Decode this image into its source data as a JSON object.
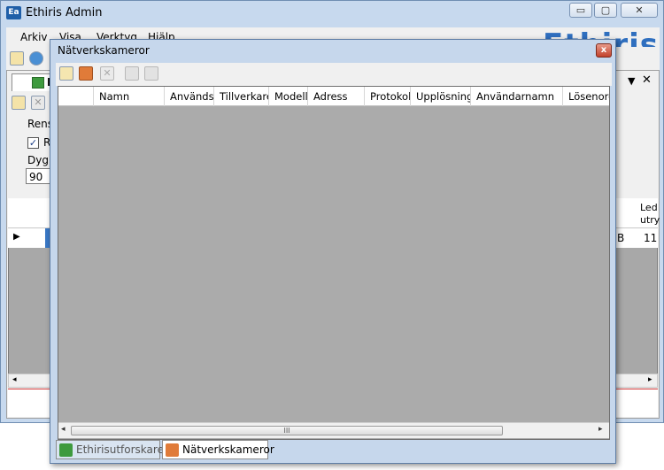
{
  "app": {
    "icon_text": "Ea",
    "title": "Ethiris Admin",
    "logo_text": "Ethiris"
  },
  "window_controls": {
    "minimize": "▭",
    "maximize": "▢",
    "close": "✕"
  },
  "menu": [
    "Arkiv",
    "Visa",
    "Verktyg",
    "Hjälp"
  ],
  "background_panel": {
    "tab_label": "L",
    "clear_label": "Rensa",
    "checkbox_label": "R",
    "checkbox_checked": true,
    "days_label": "Dygn",
    "days_value": "90",
    "grid_header_right": [
      "Led",
      "utry"
    ],
    "grid_row_value_b": "B",
    "grid_row_value_num": "11"
  },
  "dialog": {
    "title": "Nätverkskameror",
    "close_label": "x",
    "columns": [
      "Namn",
      "Används",
      "Tillverkare",
      "Modell",
      "Adress",
      "Protokoll",
      "Upplösning",
      "Användarnamn",
      "Lösenord"
    ],
    "scroll_grip": "III",
    "tabs": [
      {
        "label": "Ethirisutforskaren",
        "icon": "explorer-icon",
        "active": false
      },
      {
        "label": "Nätverkskameror",
        "icon": "camera-icon",
        "active": true
      }
    ]
  },
  "colors": {
    "accent": "#2f6fbf",
    "window_frame": "#c7d9ee",
    "grid_empty": "#ababab"
  }
}
